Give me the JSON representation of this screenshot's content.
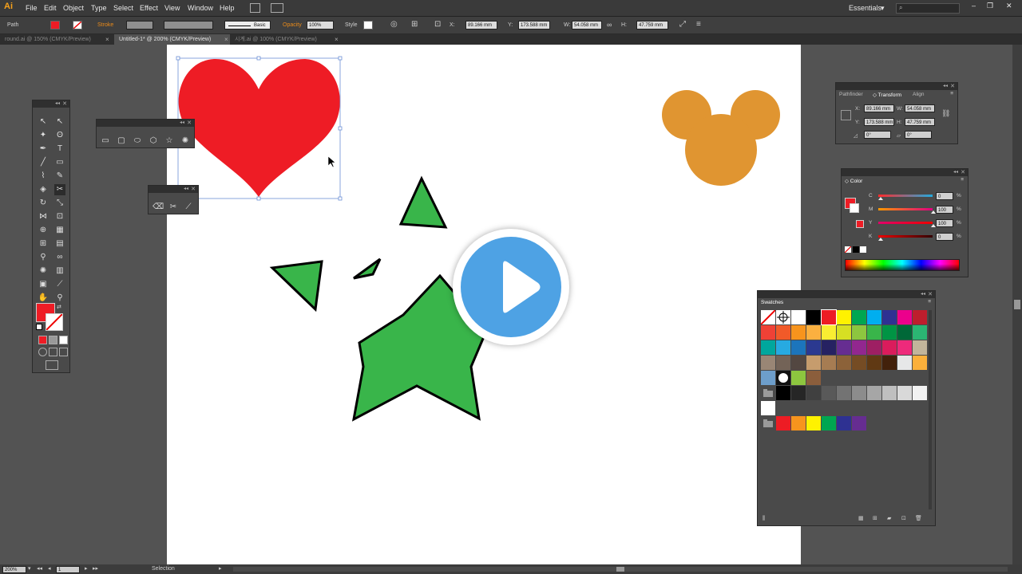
{
  "app": {
    "logo": "Ai"
  },
  "menu": [
    "File",
    "Edit",
    "Object",
    "Type",
    "Select",
    "Effect",
    "View",
    "Window",
    "Help"
  ],
  "workspace": "Essentials",
  "control": {
    "selection_type": "Path",
    "stroke_label": "Stroke",
    "brush": "Basic",
    "opacity_label": "Opacity",
    "opacity": "100%",
    "style_label": "Style",
    "x_label": "X:",
    "x": "89.166 mm",
    "y_label": "Y:",
    "y": "173.588 mm",
    "w_label": "W:",
    "w": "54.058 mm",
    "h_label": "H:",
    "h": "47.759 mm"
  },
  "tabs": [
    {
      "label": "round.ai @ 150% (CMYK/Preview)",
      "close": "×"
    },
    {
      "label": "Untitled-1* @ 200% (CMYK/Preview)",
      "close": "×"
    },
    {
      "label": "시계.ai @ 100% (CMYK/Preview)",
      "close": "×"
    }
  ],
  "transform_panel": {
    "tabs": [
      "Pathfinder",
      "◇ Transform",
      "Align"
    ],
    "x_label": "X:",
    "x": "89.166 mm",
    "y_label": "Y:",
    "y": "173.588 mm",
    "w_label": "W:",
    "w": "54.058 mm",
    "h_label": "H:",
    "h": "47.759 mm",
    "rotate": "0°",
    "shear": "0°"
  },
  "color_panel": {
    "title": "◇ Color",
    "channels": [
      {
        "label": "C",
        "value": "0",
        "pct": "%",
        "level": 0
      },
      {
        "label": "M",
        "value": "100",
        "pct": "%",
        "level": 1
      },
      {
        "label": "Y",
        "value": "100",
        "pct": "%",
        "level": 1
      },
      {
        "label": "K",
        "value": "0",
        "pct": "%",
        "level": 0
      }
    ]
  },
  "swatches_panel": {
    "title": "Swatches"
  },
  "status": {
    "zoom": "200%",
    "page": "1",
    "tool": "Selection"
  },
  "colors": {
    "heart": "#ee1c25",
    "mickey": "#e09531",
    "star": "#39b54a",
    "play": "#4ea2e4"
  }
}
